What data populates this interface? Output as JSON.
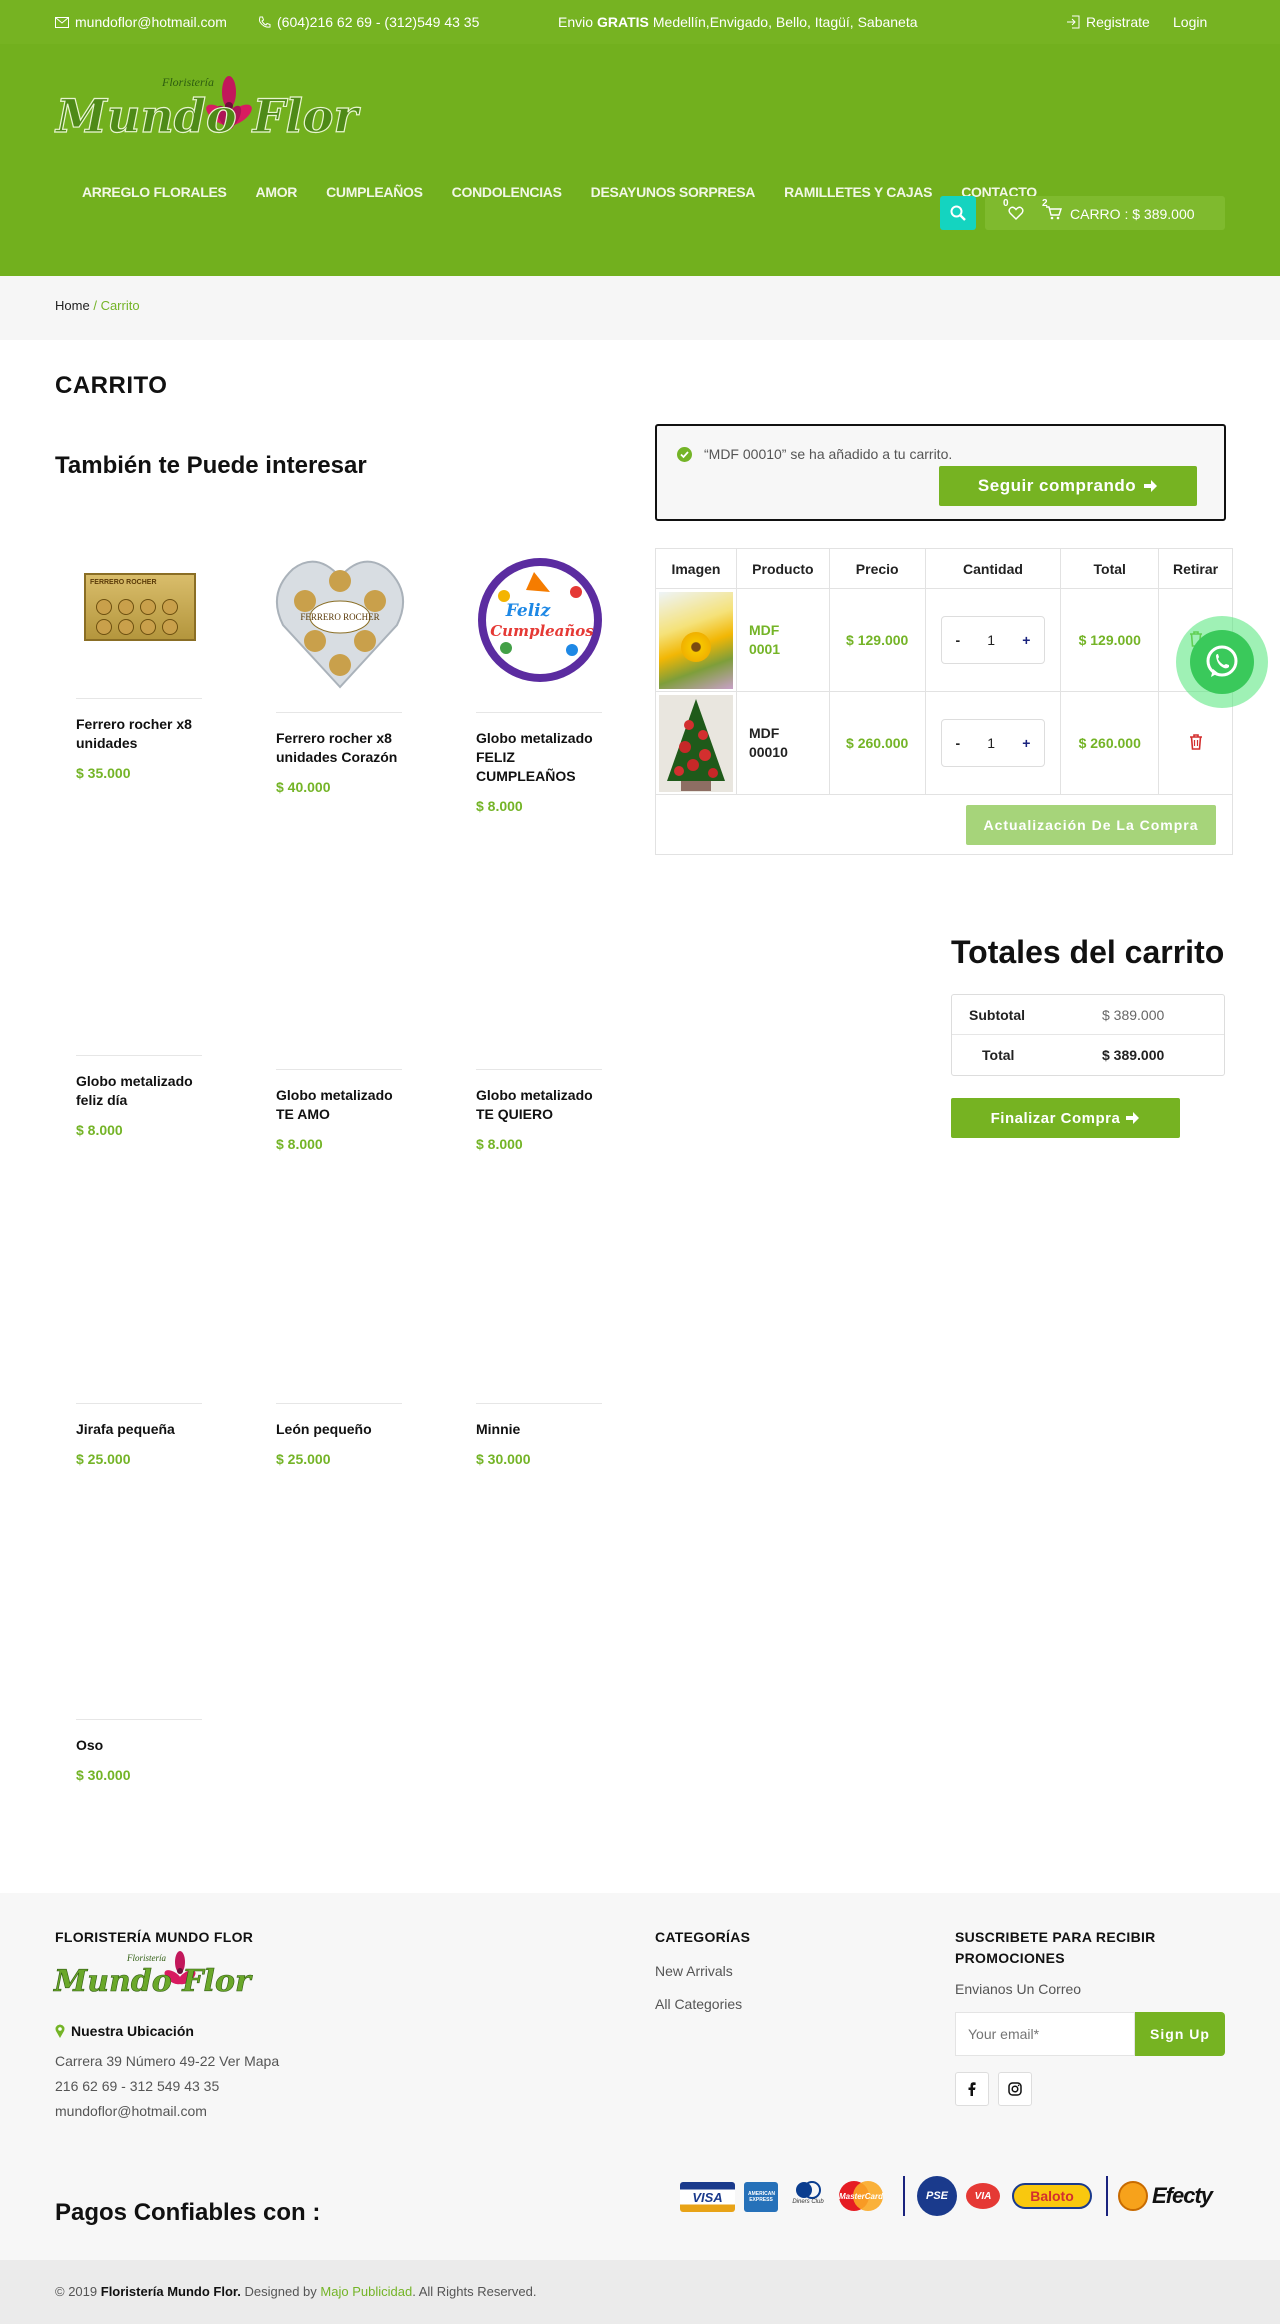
{
  "topbar": {
    "email": "mundoflor@hotmail.com",
    "phone": "(604)216 62 69 - (312)549 43 35",
    "shipping_prefix": "Envio",
    "shipping_bold": "GRATIS",
    "shipping_rest": "Medellín,Envigado, Bello, Itagüí, Sabaneta",
    "register": "Registrate",
    "login": "Login"
  },
  "logo": {
    "small": "Floristería",
    "main": "Mundo Flor"
  },
  "nav": [
    "ARREGLO FLORALES",
    "AMOR",
    "CUMPLEAÑOS",
    "CONDOLENCIAS",
    "DESAYUNOS SORPRESA",
    "RAMILLETES Y CAJAS",
    "CONTACTO"
  ],
  "cartbar": {
    "wish_count": "0",
    "cart_count": "2",
    "label": "CARRO : $ 389.000"
  },
  "breadcrumb": {
    "home": "Home",
    "sep": "/",
    "current": "Carrito"
  },
  "page_title": "CARRITO",
  "related_title": "También te Puede interesar",
  "products": [
    {
      "name": "Ferrero rocher x8 unidades",
      "price": "$ 35.000"
    },
    {
      "name": "Ferrero rocher x8 unidades Corazón",
      "price": "$ 40.000"
    },
    {
      "name": "Globo metalizado FELIZ CUMPLEAÑOS",
      "price": "$ 8.000"
    },
    {
      "name": "Globo metalizado feliz día",
      "price": "$ 8.000"
    },
    {
      "name": "Globo metalizado TE AMO",
      "price": "$ 8.000"
    },
    {
      "name": "Globo metalizado TE QUIERO",
      "price": "$ 8.000"
    },
    {
      "name": "Jirafa pequeña",
      "price": "$ 25.000"
    },
    {
      "name": "León pequeño",
      "price": "$ 25.000"
    },
    {
      "name": "Minnie",
      "price": "$ 30.000"
    },
    {
      "name": "Oso",
      "price": "$ 30.000"
    }
  ],
  "product_images": {
    "ferrero_box": "FERRERO ROCHER",
    "ferrero_heart": "FERRERO ROCHER",
    "balloon_line1": "Feliz",
    "balloon_line2": "Cumpleaños"
  },
  "notice": {
    "message": "“MDF 00010” se ha añadido a tu carrito.",
    "button": "Seguir comprando"
  },
  "cart_table": {
    "headers": [
      "Imagen",
      "Producto",
      "Precio",
      "Cantidad",
      "Total",
      "Retirar"
    ],
    "rows": [
      {
        "product": "MDF 0001",
        "price": "$ 129.000",
        "qty": "1",
        "total": "$ 129.000"
      },
      {
        "product": "MDF 00010",
        "price": "$ 260.000",
        "qty": "1",
        "total": "$ 260.000"
      }
    ],
    "minus": "-",
    "plus": "+",
    "update_button": "Actualización De La Compra"
  },
  "totals": {
    "title": "Totales del carrito",
    "subtotal_label": "Subtotal",
    "subtotal_value": "$ 389.000",
    "total_label": "Total",
    "total_value": "$ 389.000",
    "checkout": "Finalizar Compra"
  },
  "footer": {
    "col1_title": "FLORISTERÍA MUNDO FLOR",
    "location_title": "Nuestra Ubicación",
    "address": "Carrera 39 Número 49-22 Ver Mapa",
    "phones": "216 62 69 - 312 549 43 35",
    "email": "mundoflor@hotmail.com",
    "col2_title": "CATEGORÍAS",
    "cat1": "New Arrivals",
    "cat2": "All Categories",
    "col3_title": "SUSCRIBETE PARA RECIBIR PROMOCIONES",
    "col3_sub": "Envianos Un Correo",
    "email_placeholder": "Your email*",
    "signup": "Sign Up",
    "payments_title": "Pagos Confiables con :"
  },
  "payment_logos": {
    "visa": "VISA",
    "amex": "AMERICAN EXPRESS",
    "diners": "Diners Club",
    "master": "MasterCard",
    "pse": "PSE",
    "via": "VIA",
    "baloto": "Baloto",
    "efecty": "Efecty"
  },
  "copyright": {
    "prefix": "© 2019",
    "brand": "Floristería Mundo Flor.",
    "designed": "Designed by",
    "agency": "Majo Publicidad",
    "rights": ". All Rights Reserved."
  },
  "colors": {
    "brand_green": "#74b427",
    "header_green": "#72b01e",
    "teal": "#14d4c0",
    "delete_red": "#d32f2f"
  }
}
